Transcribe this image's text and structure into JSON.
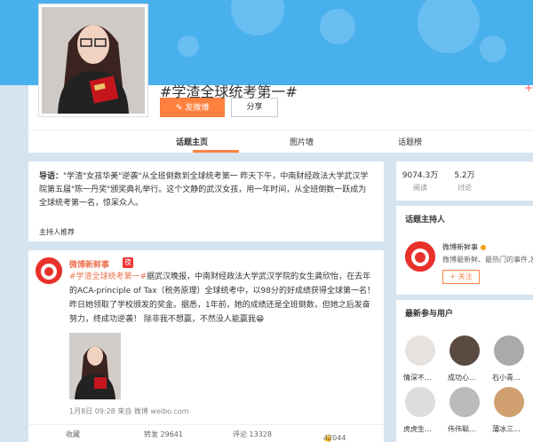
{
  "topic": {
    "title": "#学渣全球统考第一#",
    "post_button": "发微博",
    "share_button": "分享",
    "plus": "+"
  },
  "nav": {
    "tabs": [
      {
        "label": "话题主页",
        "active": true
      },
      {
        "label": "图片墙",
        "active": false
      },
      {
        "label": "话题榜",
        "active": false
      }
    ]
  },
  "guide": {
    "label": "导语：",
    "text": "\"学渣\"女孩华美\"逆袭\"从全班倒数到全球统考第一 昨天下午，中南财经政法大学武汉学院第五届\"陈一丹奖\"颁奖典礼举行。这个文静的武汉女孩，用一年时间，从全班倒数一跃成为全球统考第一名，惊呆众人。",
    "host_recommend": "主持人推荐"
  },
  "post": {
    "username": "微博新鲜事",
    "badge": "夜",
    "hashtag": "#学渣全球统考第一#",
    "body": "据武汉晚报，中南财经政法大学武汉学院的女生龚欣怡，在去年的ACA-principle of Tax（税务原理）全球统考中，以98分的好成绩获得全球第一名！昨日她领取了学校颁发的奖金。据悉，1年前，她的成绩还是全班倒数，但她之后发奋努力，终成功逆袭！ 除非我不想赢，不然没人能赢我",
    "time": "1月8日 09:28 来自 微博 weibo.com",
    "actions": {
      "favorite": "收藏",
      "repost": "转发 29641",
      "comment": "评论 13328",
      "like": "42044"
    }
  },
  "stats": [
    {
      "value": "9074.3万",
      "label": "阅读"
    },
    {
      "value": "5.2万",
      "label": "讨论"
    },
    {
      "value": "",
      "label": ""
    }
  ],
  "host": {
    "section_title": "话题主持人",
    "name": "微博新鲜事",
    "desc": "微博最新鲜、最热门的事件,发",
    "follow": "+ 关注"
  },
  "latest": {
    "section_title": "最新参与用户",
    "users": [
      {
        "name": "情深不..."
      },
      {
        "name": "成功心..."
      },
      {
        "name": "石小青..."
      },
      {
        "name": "虎虎生..."
      },
      {
        "name": "伟伟聪..."
      },
      {
        "name": "蒲冰三..."
      }
    ]
  },
  "colors": {
    "accent": "#ff8140",
    "link": "#eb7350",
    "banner": "#49b0ee"
  }
}
